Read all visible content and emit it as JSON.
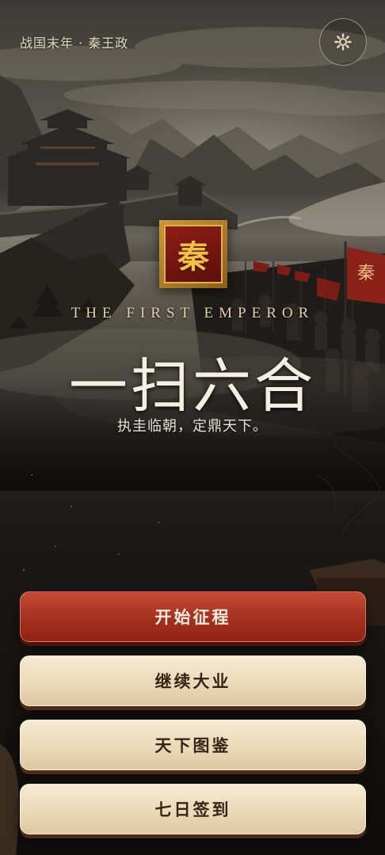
{
  "header": {
    "era_title": "战国末年 · 秦王政",
    "settings_icon": "gear-icon"
  },
  "emblem": {
    "character": "秦"
  },
  "title": {
    "subtitle_en": "THE FIRST EMPEROR",
    "main": "一扫六合",
    "tagline": "执圭临朝，定鼎天下。"
  },
  "menu": {
    "start": "开始征程",
    "continue": "继续大业",
    "atlas": "天下图鉴",
    "checkin": "七日签到"
  },
  "colors": {
    "primary_button": "#a5301f",
    "secondary_button": "#ead8b6",
    "gold_accent": "#e0b04a"
  },
  "banner_text": "秦"
}
